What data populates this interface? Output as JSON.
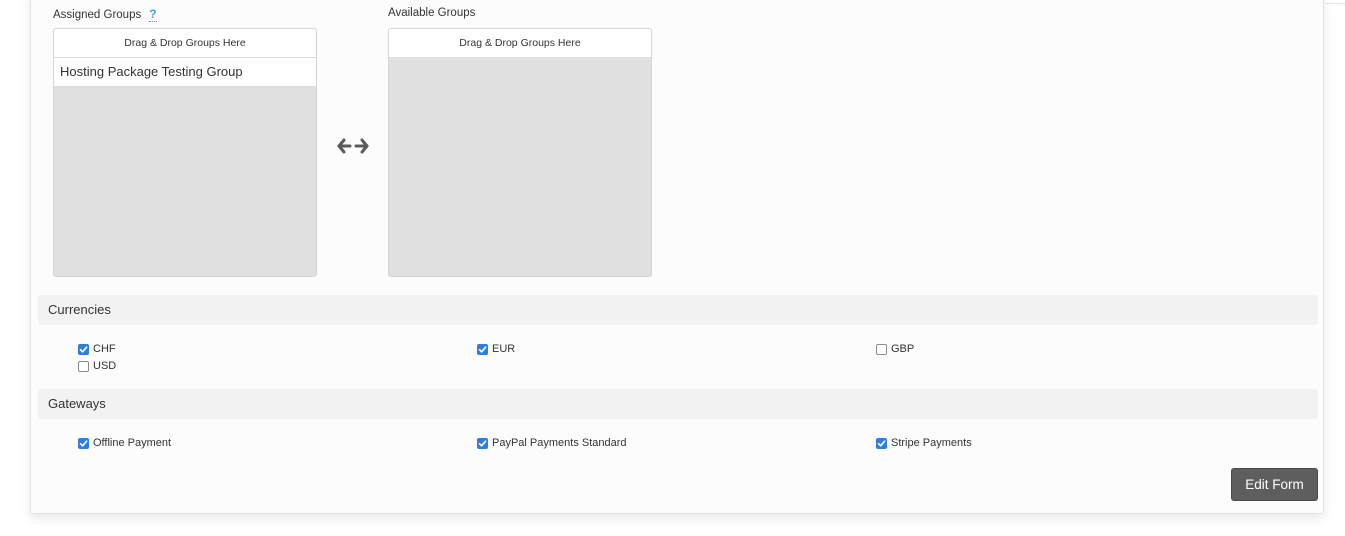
{
  "groups": {
    "assigned_label": "Assigned Groups",
    "help_glyph": "?",
    "available_label": "Available Groups",
    "assigned_box": {
      "header": "Drag & Drop Groups Here",
      "items": [
        "Hosting Package Testing Group"
      ]
    },
    "available_box": {
      "header": "Drag & Drop Groups Here",
      "items": []
    },
    "swap_icon": "left-right-arrows-icon"
  },
  "currencies": {
    "title": "Currencies",
    "items": [
      {
        "label": "CHF",
        "checked": true
      },
      {
        "label": "EUR",
        "checked": true
      },
      {
        "label": "GBP",
        "checked": false
      },
      {
        "label": "USD",
        "checked": false
      }
    ]
  },
  "gateways": {
    "title": "Gateways",
    "items": [
      {
        "label": "Offline Payment",
        "checked": true
      },
      {
        "label": "PayPal Payments Standard",
        "checked": true
      },
      {
        "label": "Stripe Payments",
        "checked": true
      }
    ]
  },
  "actions": {
    "edit_label": "Edit Form"
  },
  "colors": {
    "checkbox_accent": "#2f7de1",
    "help_icon": "#3fa3e0",
    "button_bg": "#5e5e5e"
  }
}
